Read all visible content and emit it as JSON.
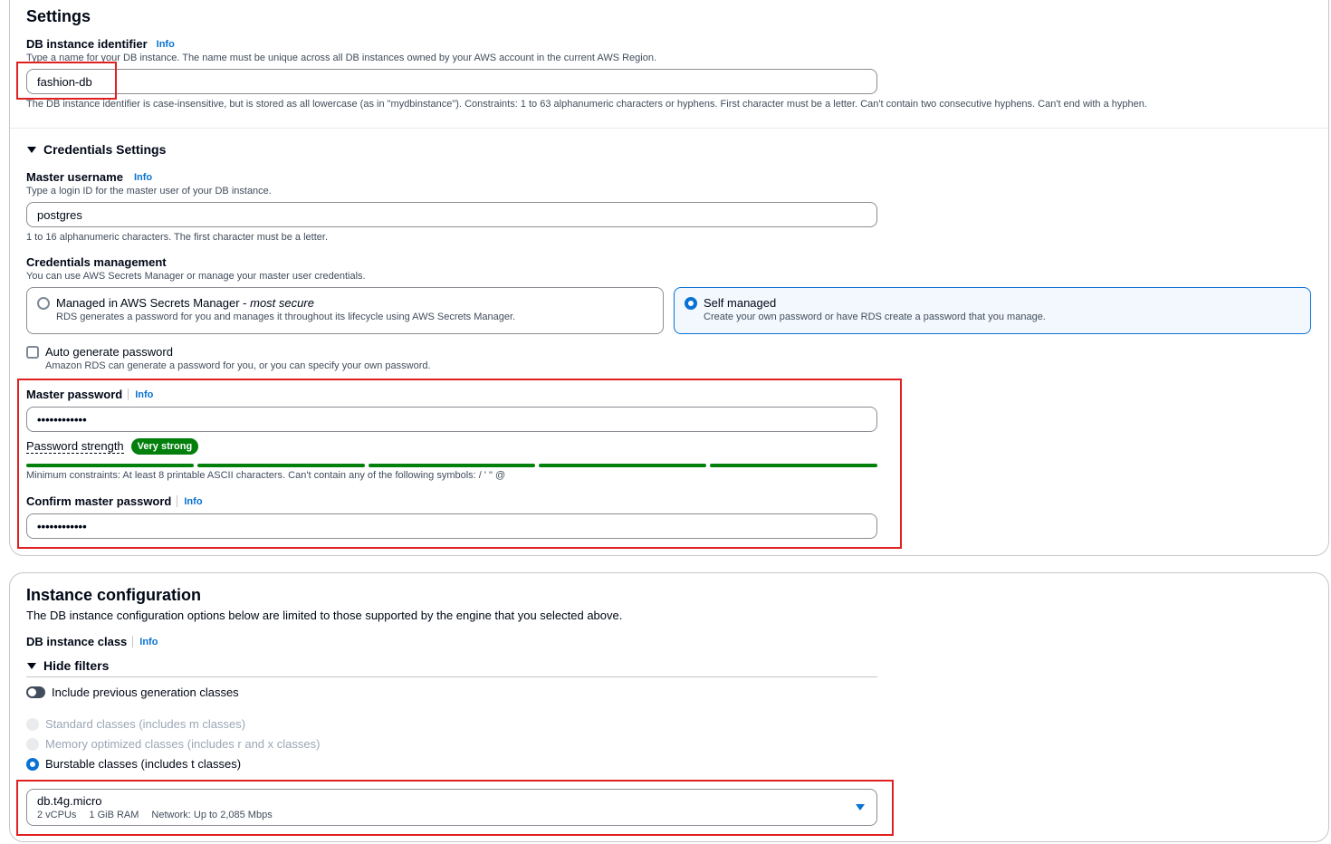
{
  "settings": {
    "title": "Settings",
    "identifier_label": "DB instance identifier",
    "info": "Info",
    "identifier_desc": "Type a name for your DB instance. The name must be unique across all DB instances owned by your AWS account in the current AWS Region.",
    "identifier_value": "fashion-db",
    "identifier_hint": "The DB instance identifier is case-insensitive, but is stored as all lowercase (as in \"mydbinstance\"). Constraints: 1 to 63 alphanumeric characters or hyphens. First character must be a letter. Can't contain two consecutive hyphens. Can't end with a hyphen."
  },
  "credentials": {
    "title": "Credentials Settings",
    "username_label": "Master username",
    "username_desc": "Type a login ID for the master user of your DB instance.",
    "username_value": "postgres",
    "username_hint": "1 to 16 alphanumeric characters. The first character must be a letter.",
    "management_label": "Credentials management",
    "management_desc": "You can use AWS Secrets Manager or manage your master user credentials.",
    "option_managed_title": "Managed in AWS Secrets Manager - ",
    "option_managed_title_em": "most secure",
    "option_managed_desc": "RDS generates a password for you and manages it throughout its lifecycle using AWS Secrets Manager.",
    "option_self_title": "Self managed",
    "option_self_desc": "Create your own password or have RDS create a password that you manage.",
    "auto_gen_label": "Auto generate password",
    "auto_gen_desc": "Amazon RDS can generate a password for you, or you can specify your own password.",
    "password_label": "Master password",
    "password_value": "••••••••••••",
    "strength_label": "Password strength",
    "strength_badge": "Very strong",
    "strength_level": 5,
    "strength_max": 5,
    "password_hint": "Minimum constraints: At least 8 printable ASCII characters. Can't contain any of the following symbols: / ' \" @",
    "confirm_label": "Confirm master password",
    "confirm_value": "••••••••••••"
  },
  "instance": {
    "title": "Instance configuration",
    "desc": "The DB instance configuration options below are limited to those supported by the engine that you selected above.",
    "class_label": "DB instance class",
    "filters_label": "Hide filters",
    "prev_gen_label": "Include previous generation classes",
    "opt_standard": "Standard classes (includes m classes)",
    "opt_memory": "Memory optimized classes (includes r and x classes)",
    "opt_burstable": "Burstable classes (includes t classes)",
    "select_value": "db.t4g.micro",
    "select_vcpu": "2 vCPUs",
    "select_ram": "1 GiB RAM",
    "select_network": "Network: Up to 2,085 Mbps"
  },
  "colors": {
    "accent": "#0972d3",
    "success": "#037f0c",
    "highlight": "#e02020"
  }
}
